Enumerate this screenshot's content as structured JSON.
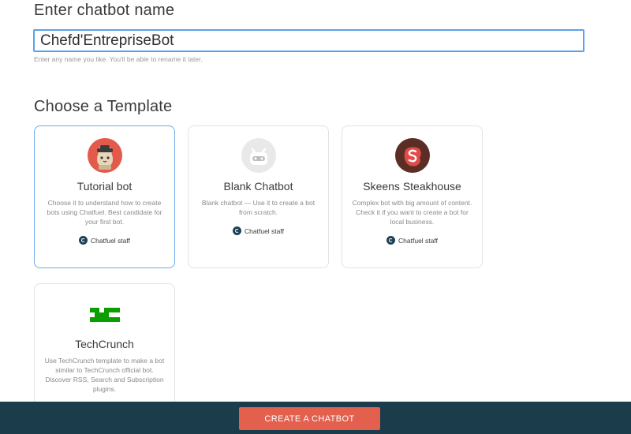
{
  "name_section": {
    "title": "Enter chatbot name",
    "value": "Chefd'EntrepriseBot",
    "hint": "Enter any name you like. You'll be able to rename it later."
  },
  "template_section": {
    "title": "Choose a Template",
    "templates": [
      {
        "title": "Tutorial bot",
        "description": "Choose it to understand how to create bots using Chatfuel. Best candidate for your first bot.",
        "author": "Chatfuel staff",
        "icon": "cat-avatar-icon",
        "selected": true
      },
      {
        "title": "Blank Chatbot",
        "description": "Blank chatbot — Use it to create a bot from scratch.",
        "author": "Chatfuel staff",
        "icon": "robot-icon",
        "selected": false
      },
      {
        "title": "Skeens Steakhouse",
        "description": "Complex bot with big amount of content. Check it if you want to create a bot for local business.",
        "author": "Chatfuel staff",
        "icon": "steak-icon",
        "selected": false
      },
      {
        "title": "TechCrunch",
        "description": "Use TechCrunch template to make a bot similar to TechCrunch official bot. Discover RSS, Search and Subscription plugins.",
        "author": "",
        "icon": "techcrunch-logo-icon",
        "selected": false
      }
    ]
  },
  "footer": {
    "cta_label": "CREATE A CHATBOT"
  },
  "colors": {
    "accent_blue": "#5aa0ea",
    "cta_red": "#e35f4e",
    "footer_bg": "#1a3c4b",
    "techcrunch_green": "#0a9e01"
  }
}
